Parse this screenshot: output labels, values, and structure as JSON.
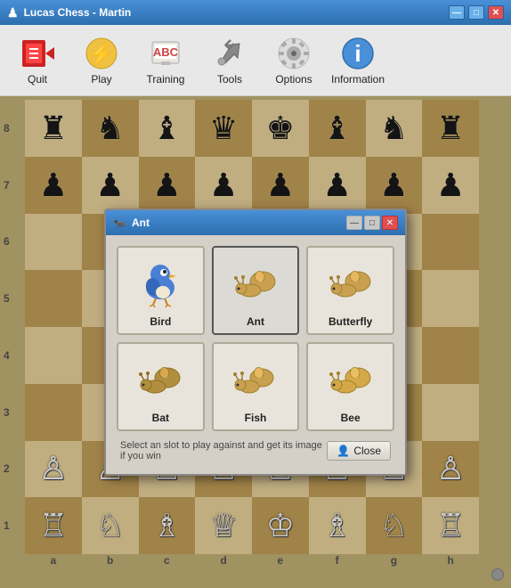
{
  "window": {
    "title": "Lucas Chess - Martin",
    "icon": "♟"
  },
  "titlebar_controls": {
    "minimize": "—",
    "maximize": "□",
    "close": "✕"
  },
  "toolbar": {
    "items": [
      {
        "id": "quit",
        "label": "Quit",
        "icon": "quit"
      },
      {
        "id": "play",
        "label": "Play",
        "icon": "play"
      },
      {
        "id": "training",
        "label": "Training",
        "icon": "training"
      },
      {
        "id": "tools",
        "label": "Tools",
        "icon": "tools"
      },
      {
        "id": "options",
        "label": "Options",
        "icon": "options"
      },
      {
        "id": "information",
        "label": "Information",
        "icon": "information"
      }
    ]
  },
  "board": {
    "row_labels": [
      "8",
      "7",
      "6",
      "5",
      "4",
      "3",
      "2",
      "1"
    ],
    "col_labels": [
      "a",
      "b",
      "c",
      "d",
      "e",
      "f",
      "g",
      "h"
    ],
    "pieces": [
      {
        "row": 0,
        "col": 0,
        "piece": "♜",
        "color": "black"
      },
      {
        "row": 0,
        "col": 1,
        "piece": "♞",
        "color": "black"
      },
      {
        "row": 0,
        "col": 2,
        "piece": "♝",
        "color": "black"
      },
      {
        "row": 0,
        "col": 3,
        "piece": "♛",
        "color": "black"
      },
      {
        "row": 0,
        "col": 4,
        "piece": "♚",
        "color": "black"
      },
      {
        "row": 0,
        "col": 5,
        "piece": "♝",
        "color": "black"
      },
      {
        "row": 0,
        "col": 6,
        "piece": "♞",
        "color": "black"
      },
      {
        "row": 0,
        "col": 7,
        "piece": "♜",
        "color": "black"
      },
      {
        "row": 1,
        "col": 0,
        "piece": "♟",
        "color": "black"
      },
      {
        "row": 1,
        "col": 1,
        "piece": "♟",
        "color": "black"
      },
      {
        "row": 1,
        "col": 2,
        "piece": "♟",
        "color": "black"
      },
      {
        "row": 1,
        "col": 3,
        "piece": "♟",
        "color": "black"
      },
      {
        "row": 1,
        "col": 4,
        "piece": "♟",
        "color": "black"
      },
      {
        "row": 1,
        "col": 5,
        "piece": "♟",
        "color": "black"
      },
      {
        "row": 1,
        "col": 6,
        "piece": "♟",
        "color": "black"
      },
      {
        "row": 1,
        "col": 7,
        "piece": "♟",
        "color": "black"
      },
      {
        "row": 6,
        "col": 0,
        "piece": "♙",
        "color": "white"
      },
      {
        "row": 6,
        "col": 1,
        "piece": "♙",
        "color": "white"
      },
      {
        "row": 6,
        "col": 2,
        "piece": "♙",
        "color": "white"
      },
      {
        "row": 6,
        "col": 3,
        "piece": "♙",
        "color": "white"
      },
      {
        "row": 6,
        "col": 4,
        "piece": "♙",
        "color": "white"
      },
      {
        "row": 6,
        "col": 5,
        "piece": "♙",
        "color": "white"
      },
      {
        "row": 6,
        "col": 6,
        "piece": "♙",
        "color": "white"
      },
      {
        "row": 6,
        "col": 7,
        "piece": "♙",
        "color": "white"
      },
      {
        "row": 7,
        "col": 0,
        "piece": "♖",
        "color": "white"
      },
      {
        "row": 7,
        "col": 1,
        "piece": "♘",
        "color": "white"
      },
      {
        "row": 7,
        "col": 2,
        "piece": "♗",
        "color": "white"
      },
      {
        "row": 7,
        "col": 3,
        "piece": "♕",
        "color": "white"
      },
      {
        "row": 7,
        "col": 4,
        "piece": "♔",
        "color": "white"
      },
      {
        "row": 7,
        "col": 5,
        "piece": "♗",
        "color": "white"
      },
      {
        "row": 7,
        "col": 6,
        "piece": "♘",
        "color": "white"
      },
      {
        "row": 7,
        "col": 7,
        "piece": "♖",
        "color": "white"
      }
    ]
  },
  "modal": {
    "title": "Ant",
    "title_icon": "🐜",
    "creatures": [
      {
        "id": "bird",
        "name": "Bird",
        "type": "bird",
        "selected": false
      },
      {
        "id": "ant",
        "name": "Ant",
        "type": "snail",
        "selected": true
      },
      {
        "id": "butterfly",
        "name": "Butterfly",
        "type": "snail",
        "selected": false
      },
      {
        "id": "bat",
        "name": "Bat",
        "type": "snail",
        "selected": false
      },
      {
        "id": "fish",
        "name": "Fish",
        "type": "snail",
        "selected": false
      },
      {
        "id": "bee",
        "name": "Bee",
        "type": "snail",
        "selected": false
      }
    ],
    "hint": "Select an slot to play against and get its image if you win",
    "close_label": "Close",
    "close_icon": "👤"
  }
}
